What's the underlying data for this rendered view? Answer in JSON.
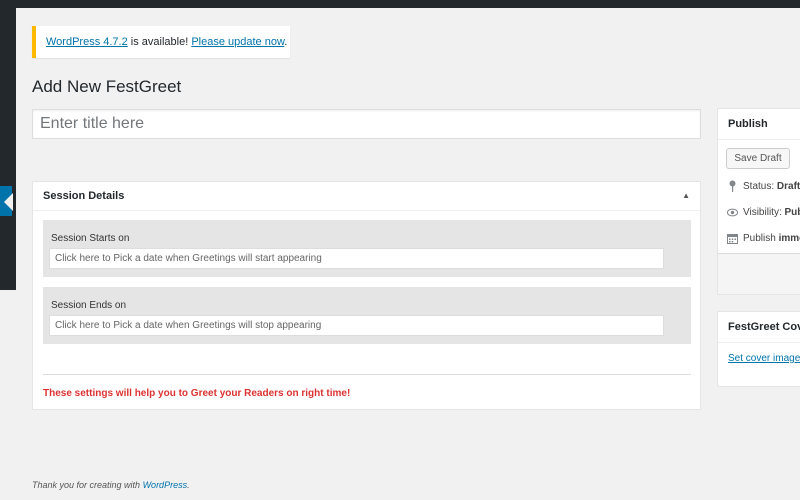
{
  "notice": {
    "version_link": "WordPress 4.7.2",
    "text": " is available! ",
    "update_link": "Please update now",
    "end": "."
  },
  "page_title": "Add New FestGreet",
  "title_placeholder": "Enter title here",
  "session": {
    "heading": "Session Details",
    "toggle": "▲",
    "start_label": "Session Starts on",
    "start_placeholder": "Click here to Pick a date when Greetings will start appearing",
    "end_label": "Session Ends on",
    "end_placeholder": "Click here to Pick a date when Greetings will stop appearing",
    "note": "These settings will help you to Greet your Readers on right time!"
  },
  "publish": {
    "heading": "Publish",
    "save_draft": "Save Draft",
    "status_label": "Status: ",
    "status_value": "Draft",
    "visibility_label": "Visibility: ",
    "visibility_value": "Public",
    "publish_label": "Publish ",
    "publish_value": "immediately"
  },
  "cover": {
    "heading": "FestGreet Cover",
    "link": "Set cover image"
  },
  "footer": {
    "text": "Thank you for creating with ",
    "link": "WordPress",
    "end": "."
  },
  "colors": {
    "accent": "#0073aa",
    "warning": "#ffb900",
    "error": "#dc3232",
    "admin_dark": "#23282d"
  }
}
